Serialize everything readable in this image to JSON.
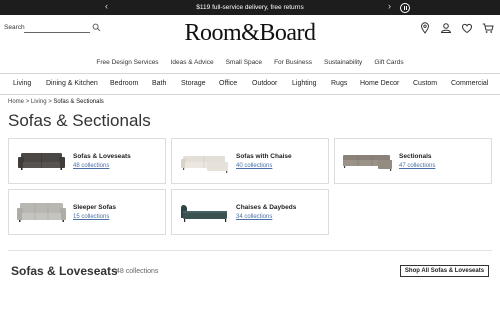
{
  "promo": {
    "text": "$119 full-service delivery, free returns"
  },
  "header": {
    "search_label": "Search",
    "search_value": "",
    "logo": "Room&Board",
    "icons": [
      "map-pin-icon",
      "account-icon",
      "heart-icon",
      "cart-icon"
    ]
  },
  "secondary_nav": [
    "Free Design Services",
    "Ideas & Advice",
    "Small Space",
    "For Business",
    "Sustainability",
    "Gift Cards"
  ],
  "main_nav": [
    "Living",
    "Dining & Kitchen",
    "Bedroom",
    "Bath",
    "Storage",
    "Office",
    "Outdoor",
    "Lighting",
    "Rugs",
    "Home Decor",
    "Custom",
    "Commercial"
  ],
  "breadcrumb": {
    "home": "Home",
    "sep": ">",
    "living": "Living",
    "current": "Sofas & Sectionals"
  },
  "page_title": "Sofas & Sectionals",
  "categories": [
    {
      "name": "Sofas & Loveseats",
      "count": "48 collections"
    },
    {
      "name": "Sofas with Chaise",
      "count": "40 collections"
    },
    {
      "name": "Sectionals",
      "count": "47 collections"
    },
    {
      "name": "Sleeper Sofas",
      "count": "15 collections"
    },
    {
      "name": "Chaises & Daybeds",
      "count": "34 collections"
    }
  ],
  "section": {
    "title": "Sofas & Loveseats",
    "count": "48 collections",
    "shop_all": "Shop All Sofas & Loveseats"
  },
  "colors": {
    "promo_bg": "#1d1d1d",
    "link": "#4a6fa5"
  }
}
